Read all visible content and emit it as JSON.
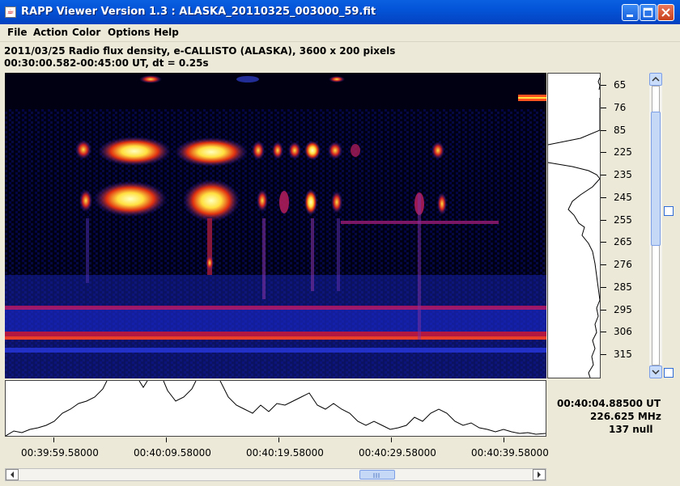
{
  "window": {
    "title": "RAPP Viewer Version 1.3 : ALASKA_20110325_003000_59.fit",
    "icon": "java-app-icon"
  },
  "menu": [
    "File",
    "Action",
    "Color",
    "Options",
    "Help"
  ],
  "info": {
    "line1": "2011/03/25  Radio flux density, e-CALLISTO (ALASKA),  3600 x 200 pixels",
    "line2": "00:30:00.582-00:45:00 UT,  dt = 0.25s"
  },
  "frequency_axis": [
    "65",
    "76",
    "85",
    "225",
    "235",
    "245",
    "255",
    "265",
    "276",
    "285",
    "295",
    "306",
    "315"
  ],
  "time_axis": [
    "00:39:59.58000",
    "00:40:09.58000",
    "00:40:19.58000",
    "00:40:29.58000",
    "00:40:39.58000"
  ],
  "readout": {
    "time": "00:40:04.88500 UT",
    "frequency": "226.625 MHz",
    "value": "137 null"
  },
  "colors": {
    "background": "#000010",
    "low": "#0a14c8",
    "mid": "#c81414",
    "high": "#ffff60"
  }
}
